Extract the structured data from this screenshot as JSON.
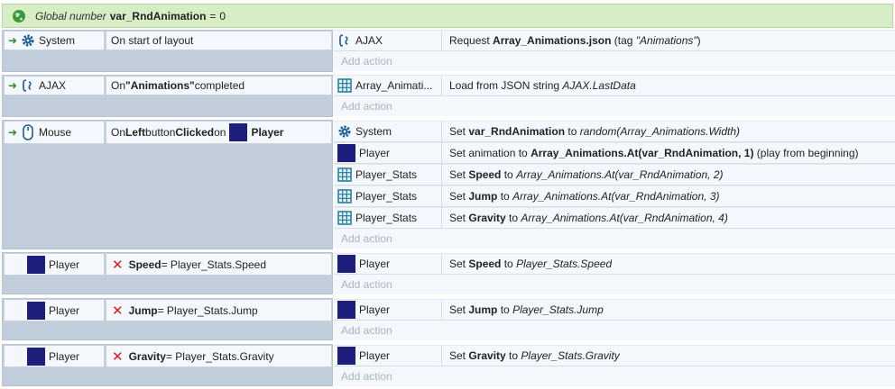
{
  "global_var": {
    "label": "Global number",
    "name": "var_RndAnimation",
    "equals": "=",
    "value": "0"
  },
  "add_action_label": "Add action",
  "events": [
    {
      "condition": {
        "object": "System",
        "text_plain": "On start of layout"
      },
      "actions": [
        {
          "object": "AJAX",
          "pre": "Request ",
          "bold": "Array_Animations.json",
          "post": " (tag ",
          "italic": "\"Animations\"",
          "end": ")"
        }
      ]
    },
    {
      "condition": {
        "object": "AJAX",
        "pre": "On ",
        "bold": "\"Animations\"",
        "post": " completed"
      },
      "actions": [
        {
          "object": "Array_Animati...",
          "pre": "Load from JSON string ",
          "italic": "AJAX.LastData"
        }
      ]
    },
    {
      "condition": {
        "object": "Mouse",
        "pre": "On ",
        "bold1": "Left",
        "mid": " button ",
        "bold2": "Clicked",
        "post": " on",
        "target": "Player"
      },
      "actions": [
        {
          "object": "System",
          "pre": "Set ",
          "bold": "var_RndAnimation",
          "mid": " to ",
          "italic": "random(Array_Animations.Width)"
        },
        {
          "object": "Player",
          "pre": "Set animation to ",
          "bold": "Array_Animations.At(var_RndAnimation, 1)",
          "post": " (play from beginning)"
        },
        {
          "object": "Player_Stats",
          "pre": "Set ",
          "bold": "Speed",
          "mid": " to ",
          "italic": "Array_Animations.At(var_RndAnimation, 2)"
        },
        {
          "object": "Player_Stats",
          "pre": "Set ",
          "bold": "Jump",
          "mid": " to ",
          "italic": "Array_Animations.At(var_RndAnimation, 3)"
        },
        {
          "object": "Player_Stats",
          "pre": "Set ",
          "bold": "Gravity",
          "mid": " to ",
          "italic": "Array_Animations.At(var_RndAnimation, 4)"
        }
      ]
    },
    {
      "condition": {
        "object": "Player",
        "bold": "Speed",
        "post": " = Player_Stats.Speed"
      },
      "actions": [
        {
          "object": "Player",
          "pre": "Set ",
          "bold": "Speed",
          "mid": " to ",
          "italic": "Player_Stats.Speed"
        }
      ]
    },
    {
      "condition": {
        "object": "Player",
        "bold": "Jump",
        "post": " = Player_Stats.Jump"
      },
      "actions": [
        {
          "object": "Player",
          "pre": "Set ",
          "bold": "Jump",
          "mid": " to ",
          "italic": "Player_Stats.Jump"
        }
      ]
    },
    {
      "condition": {
        "object": "Player",
        "bold": "Gravity",
        "post": " = Player_Stats.Gravity"
      },
      "actions": [
        {
          "object": "Player",
          "pre": "Set ",
          "bold": "Gravity",
          "mid": " to ",
          "italic": "Player_Stats.Gravity"
        }
      ]
    }
  ],
  "icons": {
    "globe": "globe-icon",
    "system": "gear-icon",
    "ajax": "ajax-icon",
    "mouse": "mouse-icon",
    "array": "grid-icon",
    "sprite": "sprite-icon",
    "invert": "invert-x-icon",
    "trigger": "trigger-arrow-icon"
  },
  "colors": {
    "global_bg": "#d6edc6",
    "event_bg": "#c3cedd",
    "cell_bg": "#f4f7fb",
    "sprite": "#1e1f7d",
    "invert": "#d42020"
  }
}
